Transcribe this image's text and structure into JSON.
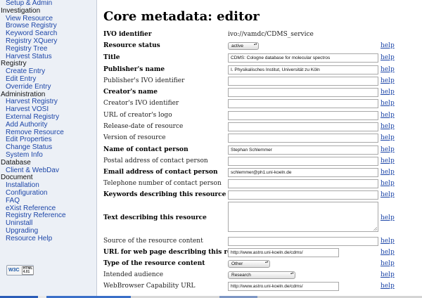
{
  "sidebar": {
    "sections": [
      {
        "heading": "",
        "items": [
          "Setup & Admin"
        ]
      },
      {
        "heading": "Investigation",
        "items": [
          "View Resource",
          "Browse Registry",
          "Keyword Search",
          "Registry XQuery",
          "Registry Tree",
          "Harvest Status"
        ]
      },
      {
        "heading": "Registry",
        "items": [
          "Create Entry",
          "Edit Entry",
          "Override Entry"
        ]
      },
      {
        "heading": "Administration",
        "items": [
          "Harvest Registry",
          "Harvest VOSI",
          "External Registry",
          "Add Authority",
          "Remove Resource",
          "Edit Properties",
          "Change Status",
          "System Info"
        ]
      },
      {
        "heading": "Database",
        "items": [
          "Client & WebDav"
        ]
      },
      {
        "heading": "Document",
        "items": [
          "Installation",
          "Configuration",
          "FAQ",
          "eXist Reference",
          "Registry Reference",
          "Uninstall",
          "Upgrading",
          "Resource Help"
        ]
      }
    ],
    "badge": {
      "main": "W3C",
      "sub": "HTML 4.01"
    }
  },
  "page": {
    "title": "Core metadata: editor"
  },
  "help_label": "help",
  "form": {
    "ivo_id": {
      "label": "IVO identifier",
      "value": "ivo://vamdc/CDMS_service"
    },
    "status": {
      "label": "Resource status",
      "value": "active"
    },
    "title": {
      "label": "Title",
      "value": "CDMS: Cologne database for molecular spectros"
    },
    "publisher": {
      "label": "Publisher's name",
      "value": "I. Physikalisches Institut, Universität zu Köln"
    },
    "publisher_ivo": {
      "label": "Publisher's IVO identifier",
      "value": ""
    },
    "creator": {
      "label": "Creator's name",
      "value": ""
    },
    "creator_ivo": {
      "label": "Creator's IVO identifier",
      "value": ""
    },
    "creator_logo": {
      "label": "URL of creator's logo",
      "value": ""
    },
    "release_date": {
      "label": "Release-date of resource",
      "value": ""
    },
    "version": {
      "label": "Version of resource",
      "value": ""
    },
    "contact_name": {
      "label": "Name of contact person",
      "value": "Stephan Schlemmer"
    },
    "postal": {
      "label": "Postal address of contact person",
      "value": ""
    },
    "email": {
      "label": "Email address of contact person",
      "value": "schlemmer@ph1.uni-koeln.de"
    },
    "telephone": {
      "label": "Telephone number of contact person",
      "value": ""
    },
    "keywords": {
      "label": "Keywords describing this resource",
      "value": ""
    },
    "description": {
      "label": "Text describing this resource",
      "value": ""
    },
    "source": {
      "label": "Source of the resource content",
      "value": ""
    },
    "url": {
      "label": "URL for web page describing this resource",
      "value": "http://www.astro.uni-koeln.de/cdms/"
    },
    "content_type": {
      "label": "Type of the resource content",
      "value": "Other"
    },
    "audience": {
      "label": "Intended audience",
      "value": "Research"
    },
    "browser_url": {
      "label": "WebBrowser Capability URL",
      "value": "http://www.astro.uni-koeln.de/cdms/"
    }
  }
}
